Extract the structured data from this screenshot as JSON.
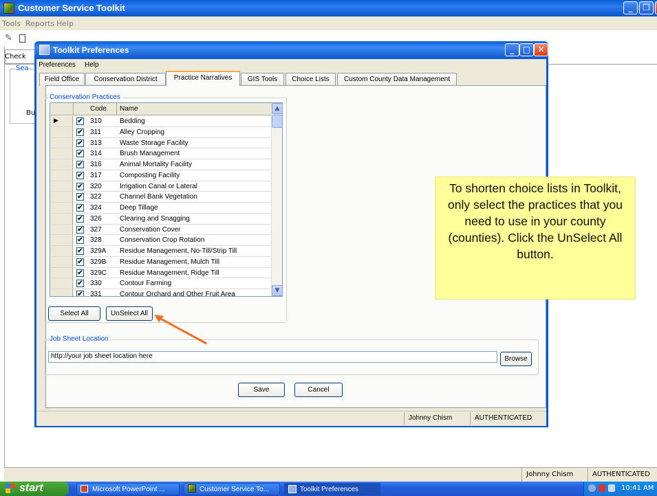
{
  "main_window": {
    "title": "Customer Service Toolkit",
    "menu": [
      "Tools",
      "Reports",
      "Help"
    ],
    "tab_partial": "Check",
    "group_partial": "Sea",
    "label_partial": "Bu",
    "status_user": "Johnny Chism",
    "status_auth": "AUTHENTICATED"
  },
  "taskbar": {
    "start_label": "start",
    "tasks": [
      "Microsoft PowerPoint ...",
      "Customer Service To...",
      "Toolkit Preferences"
    ],
    "clock": "10:41 AM"
  },
  "dialog": {
    "title": "Toolkit Preferences",
    "menu": [
      "Preferences",
      "Help"
    ],
    "tabs": [
      "Field Office",
      "Conservation District",
      "Practice Narratives",
      "GIS Tools",
      "Choice Lists",
      "Custom County Data Management"
    ],
    "active_tab": "Practice Narratives",
    "practices_group_label": "Conservation Practices",
    "grid_headers": [
      "Code",
      "Name"
    ],
    "rows": [
      {
        "code": "310",
        "name": "Bedding",
        "checked": true
      },
      {
        "code": "311",
        "name": "Alley Cropping",
        "checked": true
      },
      {
        "code": "313",
        "name": "Waste Storage Facility",
        "checked": true
      },
      {
        "code": "314",
        "name": "Brush Management",
        "checked": true
      },
      {
        "code": "316",
        "name": "Animal Mortality Facility",
        "checked": true
      },
      {
        "code": "317",
        "name": "Composting Facility",
        "checked": true
      },
      {
        "code": "320",
        "name": "Irrigation Canal or Lateral",
        "checked": true
      },
      {
        "code": "322",
        "name": "Channel Bank Vegetation",
        "checked": true
      },
      {
        "code": "324",
        "name": "Deep Tillage",
        "checked": true
      },
      {
        "code": "326",
        "name": "Clearing and Snagging",
        "checked": true
      },
      {
        "code": "327",
        "name": "Conservation Cover",
        "checked": true
      },
      {
        "code": "328",
        "name": "Conservation Crop Rotation",
        "checked": true
      },
      {
        "code": "329A",
        "name": "Residue Management, No-Till/Strip Till",
        "checked": true
      },
      {
        "code": "329B",
        "name": "Residue Management, Mulch Till",
        "checked": true
      },
      {
        "code": "329C",
        "name": "Residue Management, Ridge Till",
        "checked": true
      },
      {
        "code": "330",
        "name": "Contour Farming",
        "checked": true
      },
      {
        "code": "331",
        "name": "Contour Orchard and Other Fruit Area",
        "checked": true
      }
    ],
    "select_all_label": "Select All",
    "unselect_all_label": "UnSelect All",
    "job_sheet_group_label": "Job Sheet Location",
    "job_sheet_value": "http://your job sheet location here",
    "browse_label": "Browse",
    "save_label": "Save",
    "cancel_label": "Cancel",
    "status_user": "Johnny Chism",
    "status_auth": "AUTHENTICATED"
  },
  "callout": {
    "text": "To shorten choice lists in Toolkit, only select the practices that you need to use in your county (counties). Click the UnSelect All button.",
    "arrow_color": "#f07020"
  }
}
